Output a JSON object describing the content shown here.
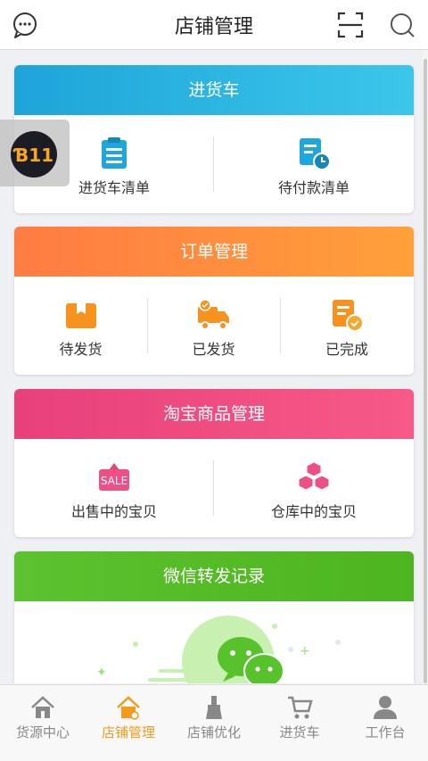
{
  "header": {
    "title": "店铺管理"
  },
  "cards": [
    {
      "title": "进货车",
      "items": [
        "进货车清单",
        "待付款清单"
      ]
    },
    {
      "title": "订单管理",
      "items": [
        "待发货",
        "已发货",
        "已完成"
      ]
    },
    {
      "title": "淘宝商品管理",
      "items": [
        "出售中的宝贝",
        "仓库中的宝贝"
      ],
      "sale_text": "SALE"
    },
    {
      "title": "微信转发记录"
    }
  ],
  "float_button": {
    "logo_text": "Ɓ11"
  },
  "tabs": [
    {
      "label": "货源中心",
      "icon": "home-icon",
      "active": false
    },
    {
      "label": "店铺管理",
      "icon": "store-home-icon",
      "active": true
    },
    {
      "label": "店铺优化",
      "icon": "brush-icon",
      "active": false
    },
    {
      "label": "进货车",
      "icon": "cart-icon",
      "active": false
    },
    {
      "label": "工作台",
      "icon": "person-icon",
      "active": false
    }
  ],
  "colors": {
    "accent": "#f39b1c",
    "blue": "#1ea4d9",
    "orange": "#ff8c3a",
    "pink": "#e8407c",
    "green": "#5cc22f"
  }
}
